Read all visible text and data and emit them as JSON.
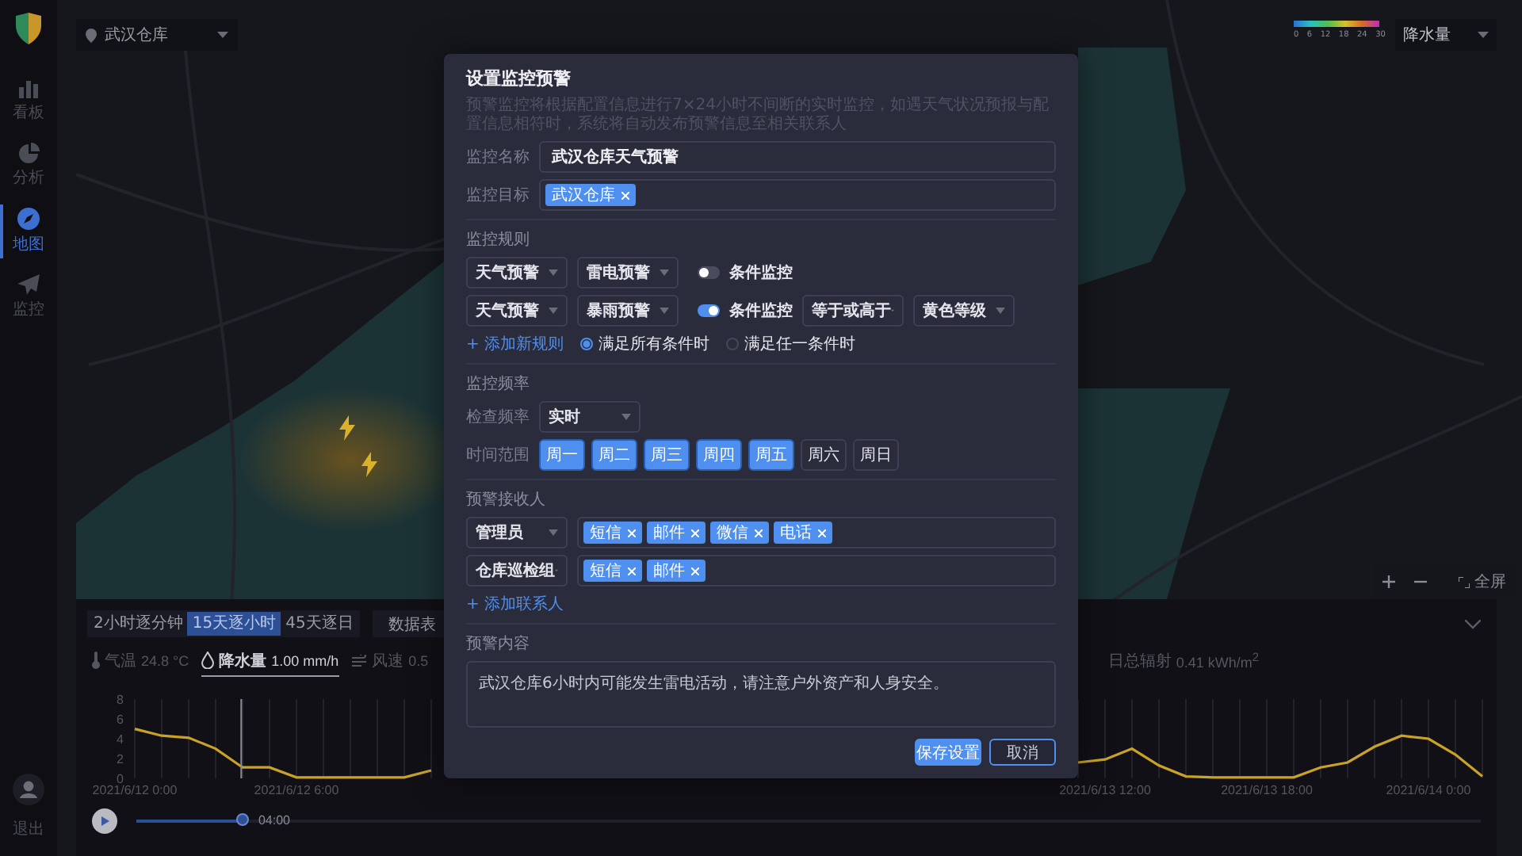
{
  "sidebar": {
    "items": [
      {
        "label": "看板",
        "kind": "board",
        "selected": false
      },
      {
        "label": "分析",
        "kind": "analysis",
        "selected": false
      },
      {
        "label": "地图",
        "kind": "map",
        "selected": true
      },
      {
        "label": "监控",
        "kind": "monitor",
        "selected": false
      }
    ],
    "exit_label": "退出"
  },
  "location_selector": {
    "value": "武汉仓库"
  },
  "legend": {
    "ticks": [
      "0",
      "6",
      "12",
      "18",
      "24",
      "30"
    ]
  },
  "layer_selector": {
    "value": "降水量"
  },
  "map_controls": {
    "fullscreen_label": "全屏"
  },
  "bottom_panel": {
    "tabs": [
      {
        "label": "2小时逐分钟",
        "selected": false
      },
      {
        "label": "15天逐小时",
        "selected": true
      },
      {
        "label": "45天逐日",
        "selected": false
      }
    ],
    "table_button": "数据表",
    "metrics": [
      {
        "kind": "temperature",
        "label": "气温",
        "value": "24.8 °C",
        "selected": false
      },
      {
        "kind": "rain",
        "label": "降水量",
        "value": "1.00 mm/h",
        "selected": true
      },
      {
        "kind": "wind",
        "label": "风速",
        "value": "0.5",
        "selected": false
      },
      {
        "kind": "radiation",
        "label": "日总辐射",
        "value": "0.41 kWh/m$^{2}$",
        "selected": false
      }
    ],
    "chart_data": {
      "type": "line",
      "categories": [
        "2021/6/12 0:00",
        null,
        null,
        null,
        null,
        null,
        "2021/6/12 6:00",
        null,
        null,
        null,
        null,
        null,
        null,
        null,
        null,
        null,
        null,
        null,
        null,
        null,
        null,
        null,
        null,
        null,
        null,
        null,
        null,
        null,
        null,
        null,
        null,
        null,
        null,
        null,
        null,
        null,
        "2021/6/13 12:00",
        null,
        null,
        null,
        null,
        null,
        "2021/6/13 18:00",
        null,
        null,
        null,
        null,
        null,
        "2021/6/14 0:00",
        null,
        null
      ],
      "series": [
        {
          "color": "#c9a227",
          "values": [
            5.0,
            4.3,
            4.1,
            3.0,
            1.1,
            1.1,
            0.1,
            0.1,
            0.1,
            0.1,
            0.1,
            0.8,
            null,
            null,
            null,
            null,
            null,
            null,
            null,
            null,
            null,
            null,
            null,
            null,
            null,
            null,
            null,
            null,
            null,
            null,
            null,
            null,
            null,
            null,
            null,
            1.6,
            1.9,
            3.0,
            1.3,
            0.2,
            0.1,
            0.1,
            0.1,
            0.1,
            1.1,
            1.6,
            3.2,
            4.3,
            4.0,
            2.4,
            0.2
          ]
        }
      ],
      "ylim": [
        0,
        8
      ],
      "yticks": [
        0,
        2,
        4,
        6,
        8
      ],
      "grid": true
    },
    "playback": {
      "level": 0.079,
      "time": "04:00"
    }
  },
  "dialog": {
    "title": "设置监控预警",
    "description": "预警监控将根据配置信息进行7×24小时不间断的实时监控，如遇天气状况预报与配置信息相符时，系统将自动发布预警信息至相关联系人",
    "name_field": {
      "label": "监控名称",
      "value": "武汉仓库天气预警"
    },
    "target_field": {
      "label": "监控目标",
      "tags": [
        "武汉仓库"
      ]
    },
    "rules": {
      "heading": "监控规则",
      "items": [
        {
          "type": "天气预警",
          "subtype": "雷电预警",
          "condition_label": "条件监控",
          "on": false
        },
        {
          "type": "天气预警",
          "subtype": "暴雨预警",
          "condition_label": "条件监控",
          "on": true,
          "operator": "等于或高于",
          "level_value": "黄色等级"
        }
      ],
      "add_link": "+ 添加新规则",
      "match_options": [
        {
          "label": "满足所有条件时",
          "selected": true
        },
        {
          "label": "满足任一条件时",
          "selected": false
        }
      ]
    },
    "frequency": {
      "heading": "监控频率",
      "check_label": "检查频率",
      "check_value": "实时",
      "range_label": "时间范围",
      "days": [
        {
          "label": "周一",
          "selected": true
        },
        {
          "label": "周二",
          "selected": true
        },
        {
          "label": "周三",
          "selected": true
        },
        {
          "label": "周四",
          "selected": true
        },
        {
          "label": "周五",
          "selected": true
        },
        {
          "label": "周六",
          "selected": false
        },
        {
          "label": "周日",
          "selected": false
        }
      ]
    },
    "recipients": {
      "heading": "预警接收人",
      "items": [
        {
          "group": "管理员",
          "channels": [
            "短信",
            "邮件",
            "微信",
            "电话"
          ]
        },
        {
          "group": "仓库巡检组",
          "channels": [
            "短信",
            "邮件"
          ]
        }
      ],
      "add_link": "+ 添加联系人"
    },
    "content": {
      "heading": "预警内容",
      "value": "武汉仓库6小时内可能发生雷电活动，请注意户外资产和人身安全。"
    },
    "buttons": [
      {
        "label": "保存设置",
        "kind": "primary"
      },
      {
        "label": "取消",
        "kind": "secondary"
      }
    ]
  }
}
